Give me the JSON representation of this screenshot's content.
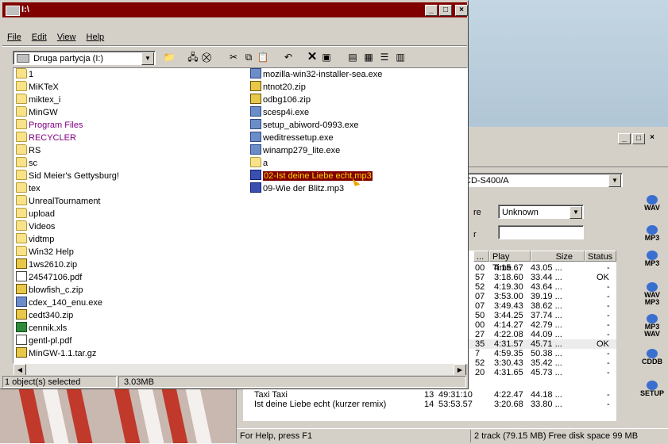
{
  "explorer": {
    "title": "I:\\",
    "menu": [
      "File",
      "Edit",
      "View",
      "Help"
    ],
    "address": "Druga partycja (I:)",
    "left_column": [
      {
        "name": "1",
        "icon": "folder-icon"
      },
      {
        "name": "MiKTeX",
        "icon": "folder-icon"
      },
      {
        "name": "miktex_i",
        "icon": "folder-icon"
      },
      {
        "name": "MinGW",
        "icon": "folder-icon"
      },
      {
        "name": "Program Files",
        "icon": "folder-icon",
        "color": "#800080"
      },
      {
        "name": "RECYCLER",
        "icon": "folder-icon",
        "color": "#800080"
      },
      {
        "name": "RS",
        "icon": "folder-icon"
      },
      {
        "name": "sc",
        "icon": "folder-icon"
      },
      {
        "name": "Sid Meier's Gettysburg!",
        "icon": "folder-icon"
      },
      {
        "name": "tex",
        "icon": "folder-icon"
      },
      {
        "name": "UnrealTournament",
        "icon": "folder-icon"
      },
      {
        "name": "upload",
        "icon": "folder-icon"
      },
      {
        "name": "Videos",
        "icon": "folder-icon"
      },
      {
        "name": "vidtmp",
        "icon": "folder-icon"
      },
      {
        "name": "Win32 Help",
        "icon": "folder-icon"
      },
      {
        "name": "1ws2610.zip",
        "icon": "zip-icon"
      },
      {
        "name": "24547106.pdf",
        "icon": "pdf-icon"
      },
      {
        "name": "blowfish_c.zip",
        "icon": "zip-icon"
      },
      {
        "name": "cdex_140_enu.exe",
        "icon": "exe-icon"
      },
      {
        "name": "cedt340.zip",
        "icon": "zip-icon"
      },
      {
        "name": "cennik.xls",
        "icon": "xls-icon"
      },
      {
        "name": "gentl-pl.pdf",
        "icon": "pdf-icon"
      },
      {
        "name": "MinGW-1.1.tar.gz",
        "icon": "zip-icon"
      }
    ],
    "right_column": [
      {
        "name": "mozilla-win32-installer-sea.exe",
        "icon": "exe-icon"
      },
      {
        "name": "ntnot20.zip",
        "icon": "zip-icon"
      },
      {
        "name": "odbg106.zip",
        "icon": "zip-icon"
      },
      {
        "name": "scesp4i.exe",
        "icon": "exe-icon"
      },
      {
        "name": "setup_abiword-0993.exe",
        "icon": "exe-icon"
      },
      {
        "name": "weditressetup.exe",
        "icon": "exe-icon"
      },
      {
        "name": "winamp279_lite.exe",
        "icon": "exe-icon"
      },
      {
        "name": "a",
        "icon": "folder-icon"
      },
      {
        "name": "02-Ist deine Liebe echt.mp3",
        "icon": "mp3-icon",
        "selected": true
      },
      {
        "name": "09-Wie der Blitz.mp3",
        "icon": "mp3-icon"
      }
    ],
    "status_left": "1 object(s) selected",
    "status_size": "3.03MB"
  },
  "cdex": {
    "drive": "CD-S400/A",
    "genre_label": "re",
    "genre_value": "Unknown",
    "year_label": "r",
    "columns": [
      "...",
      "Play Time",
      "Size",
      "Status"
    ],
    "rows": [
      {
        "a": "00",
        "time": "4:15.67",
        "size": "43.05 ...",
        "status": "-"
      },
      {
        "a": "57",
        "time": "3:18.60",
        "size": "33.44 ...",
        "status": "OK"
      },
      {
        "a": "52",
        "time": "4:19.30",
        "size": "43.64 ...",
        "status": "-"
      },
      {
        "a": "07",
        "time": "3:53.00",
        "size": "39.19 ...",
        "status": "-"
      },
      {
        "a": "07",
        "time": "3:49.43",
        "size": "38.62 ...",
        "status": "-"
      },
      {
        "a": "50",
        "time": "3:44.25",
        "size": "37.74 ...",
        "status": "-"
      },
      {
        "a": "00",
        "time": "4:14.27",
        "size": "42.79 ...",
        "status": "-"
      },
      {
        "a": "27",
        "time": "4:22.08",
        "size": "44.09 ...",
        "status": "-"
      },
      {
        "a": "35",
        "time": "4:31.57",
        "size": "45.71 ...",
        "status": "OK"
      },
      {
        "a": "7",
        "time": "4:59.35",
        "size": "50.38 ...",
        "status": "-"
      },
      {
        "a": "52",
        "time": "3:30.43",
        "size": "35.42 ...",
        "status": "-"
      },
      {
        "a": "20",
        "time": "4:31.65",
        "size": "45.73 ...",
        "status": "-"
      }
    ],
    "tail_rows": [
      {
        "title": "Taxi Taxi",
        "num": "13",
        "start": "49:31:10",
        "time": "4:22.47",
        "size": "44.18 ...",
        "status": "-"
      },
      {
        "title": "Ist deine Liebe echt (kurzer remix)",
        "num": "14",
        "start": "53:53.57",
        "time": "3:20.68",
        "size": "33.80 ...",
        "status": "-"
      }
    ],
    "side_buttons": [
      "WAV",
      "MP3",
      "MP3",
      "WAV MP3",
      "MP3 WAV",
      "CDDB",
      "SETUP"
    ],
    "status_help": "For Help, press F1",
    "status_info": "2 track (79.15 MB) Free disk space  99 MB"
  }
}
